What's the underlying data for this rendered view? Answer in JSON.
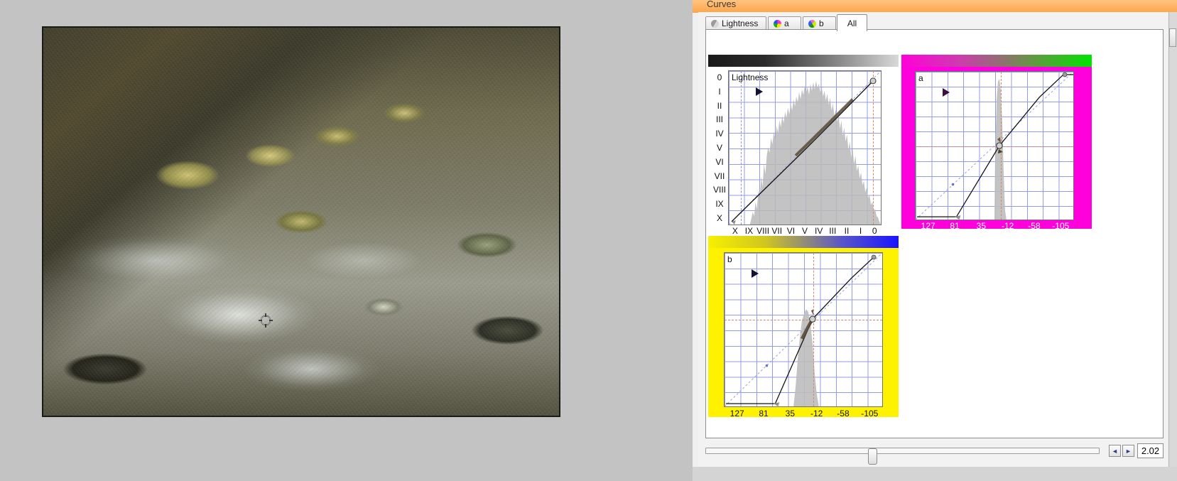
{
  "window": {
    "title": "Curves",
    "title_bg": "#ffb463"
  },
  "tabs": [
    {
      "id": "lightness",
      "label": "Lightness",
      "icon": "channel-lightness-icon",
      "active": false
    },
    {
      "id": "a",
      "label": "a",
      "icon": "channel-a-icon",
      "active": false
    },
    {
      "id": "b",
      "label": "b",
      "icon": "channel-b-icon",
      "active": false
    },
    {
      "id": "all",
      "label": "All",
      "icon": "",
      "active": true
    }
  ],
  "panels": {
    "lightness": {
      "name": "Lightness",
      "label": "Lightness",
      "gradient_from": "#1a1a1a",
      "gradient_to": "#d8d8d8",
      "y_labels": [
        "0",
        "I",
        "II",
        "III",
        "IV",
        "V",
        "VI",
        "VII",
        "VIII",
        "IX",
        "X"
      ],
      "x_labels": [
        "X",
        "IX",
        "VIII",
        "VII",
        "VI",
        "V",
        "IV",
        "III",
        "II",
        "I",
        "0"
      ],
      "label_color": "#111111"
    },
    "a": {
      "name": "a",
      "label": "a",
      "gradient_from": "#ff00d8",
      "gradient_to": "#00e400",
      "frame_color": "#ff00dc",
      "x_labels": [
        "127",
        "81",
        "35",
        "-12",
        "-58",
        "-105"
      ],
      "label_color": "#ffffff"
    },
    "b": {
      "name": "b",
      "label": "b",
      "gradient_from": "#f7f000",
      "gradient_to": "#1a14ff",
      "frame_color": "#fff200",
      "x_labels": [
        "127",
        "81",
        "35",
        "-12",
        "-58",
        "-105"
      ],
      "label_color": "#111111"
    }
  },
  "bottom": {
    "zoom_value": "2.02",
    "left_arrow": "◄",
    "right_arrow": "►",
    "slider_position_pct": 41
  },
  "chart_data": [
    {
      "type": "line",
      "title": "Lightness",
      "xlabel": "",
      "ylabel": "",
      "x_tick_labels": [
        "X",
        "IX",
        "VIII",
        "VII",
        "VI",
        "V",
        "IV",
        "III",
        "II",
        "I",
        "0"
      ],
      "y_tick_labels": [
        "0",
        "I",
        "II",
        "III",
        "IV",
        "V",
        "VI",
        "VII",
        "VIII",
        "IX",
        "X"
      ],
      "grid": true,
      "xlim": [
        0,
        100
      ],
      "ylim": [
        0,
        100
      ],
      "series": [
        {
          "name": "curve",
          "points": [
            [
              2,
              1
            ],
            [
              20,
              22
            ],
            [
              40,
              46
            ],
            [
              60,
              67
            ],
            [
              78,
              84
            ],
            [
              95,
              97
            ],
            [
              100,
              100
            ]
          ]
        },
        {
          "name": "identity-diagonal",
          "points": [
            [
              0,
              0
            ],
            [
              100,
              100
            ]
          ]
        }
      ],
      "histogram": {
        "name": "lightness-histogram",
        "bins": [
          2,
          3,
          5,
          9,
          14,
          22,
          34,
          48,
          62,
          76,
          88,
          95,
          99,
          96,
          90,
          80,
          68,
          55,
          42,
          30,
          20,
          12,
          7,
          4,
          2
        ]
      },
      "control_points": [
        [
          95,
          97
        ]
      ],
      "guides": {
        "vertical_blue": 8,
        "vertical_red": 94
      }
    },
    {
      "type": "line",
      "title": "a",
      "xlabel": "",
      "ylabel": "",
      "x_tick_labels": [
        "127",
        "81",
        "35",
        "-12",
        "-58",
        "-105"
      ],
      "grid": true,
      "xlim": [
        0,
        100
      ],
      "ylim": [
        0,
        100
      ],
      "series": [
        {
          "name": "curve",
          "points": [
            [
              0,
              2
            ],
            [
              26,
              2
            ],
            [
              50,
              50
            ],
            [
              62,
              68
            ],
            [
              82,
              97
            ],
            [
              100,
              99
            ]
          ]
        },
        {
          "name": "identity-diagonal",
          "points": [
            [
              0,
              0
            ],
            [
              100,
              100
            ]
          ]
        }
      ],
      "histogram": {
        "name": "a-histogram",
        "bins": [
          0,
          0,
          0,
          0,
          0,
          0,
          0,
          0,
          0,
          0,
          2,
          28,
          86,
          96,
          40,
          6,
          1,
          0,
          0,
          0,
          0,
          0,
          0,
          0,
          0
        ]
      },
      "control_points": [
        [
          50,
          50
        ],
        [
          96,
          99
        ]
      ],
      "guides": {
        "vertical_red": 52,
        "horizontal_red": 50
      }
    },
    {
      "type": "line",
      "title": "b",
      "xlabel": "",
      "ylabel": "",
      "x_tick_labels": [
        "127",
        "81",
        "35",
        "-12",
        "-58",
        "-105"
      ],
      "grid": true,
      "xlim": [
        0,
        100
      ],
      "ylim": [
        0,
        100
      ],
      "series": [
        {
          "name": "curve",
          "points": [
            [
              0,
              2
            ],
            [
              32,
              2
            ],
            [
              50,
              29
            ],
            [
              62,
              57
            ],
            [
              80,
              86
            ],
            [
              96,
              99
            ]
          ]
        },
        {
          "name": "identity-diagonal",
          "points": [
            [
              0,
              0
            ],
            [
              100,
              100
            ]
          ]
        }
      ],
      "histogram": {
        "name": "b-histogram",
        "bins": [
          0,
          0,
          0,
          0,
          0,
          0,
          0,
          1,
          4,
          12,
          26,
          44,
          62,
          70,
          52,
          26,
          8,
          2,
          0,
          0,
          0,
          0,
          0,
          0,
          0
        ]
      },
      "control_points": [
        [
          58,
          57
        ]
      ],
      "guides": {
        "vertical_red": 58,
        "horizontal_red": 57
      }
    }
  ]
}
